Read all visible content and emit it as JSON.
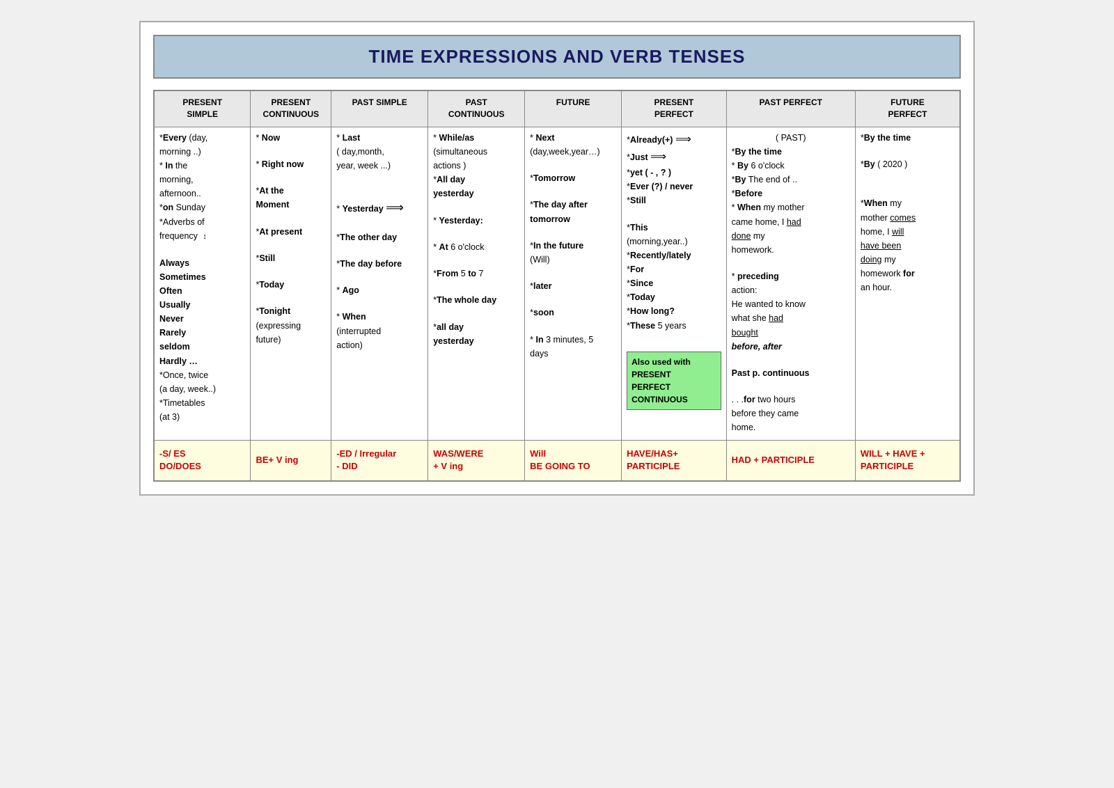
{
  "title": "TIME EXPRESSIONS AND VERB TENSES",
  "columns": [
    {
      "id": "present-simple",
      "line1": "PRESENT",
      "line2": "SIMPLE"
    },
    {
      "id": "present-continuous",
      "line1": "PRESENT",
      "line2": "CONTINUOUS"
    },
    {
      "id": "past-simple",
      "line1": "PAST SIMPLE",
      "line2": ""
    },
    {
      "id": "past-continuous",
      "line1": "PAST",
      "line2": "CONTINUOUS"
    },
    {
      "id": "future",
      "line1": "FUTURE",
      "line2": ""
    },
    {
      "id": "present-perfect",
      "line1": "PRESENT",
      "line2": "PERFECT"
    },
    {
      "id": "past-perfect",
      "line1": "PAST PERFECT",
      "line2": ""
    },
    {
      "id": "future-perfect",
      "line1": "FUTURE",
      "line2": "PERFECT"
    }
  ],
  "footer": [
    "-S/ ES\nDO/DOES",
    "BE+ V ing",
    "-ED / Irregular\n- DID",
    "WAS/WERE\n+ V ing",
    "Will\nBE GOING TO",
    "HAVE/HAS+\nPARTICIPLE",
    "HAD + PARTICIPLE",
    "WILL + HAVE +\nPARTICIPLE"
  ]
}
